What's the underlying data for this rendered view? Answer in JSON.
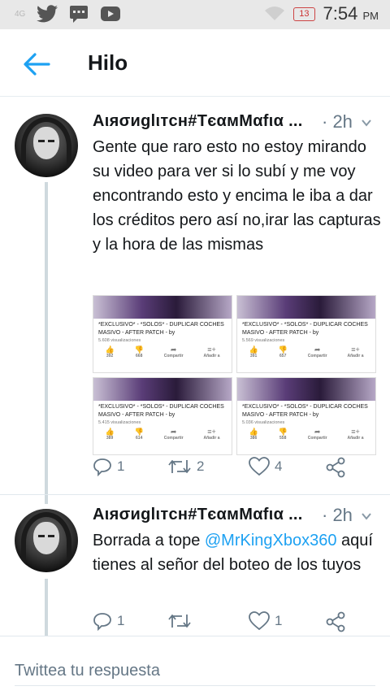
{
  "status_bar": {
    "network": "4G",
    "notification_count": "13",
    "time": "7:54",
    "ampm": "PM",
    "icons": [
      "twitter-icon",
      "message-icon",
      "youtube-icon",
      "wifi-icon"
    ]
  },
  "app_bar": {
    "title": "Hilo",
    "back_icon": "arrow-left-icon",
    "accent": "#1da1f2"
  },
  "tweets": [
    {
      "name": "Aιяσиglιтcн#TєαмMαfια ...",
      "time": "· 2h",
      "text": "Gente que raro esto no estoy mirando su video para ver si lo subí y me voy encontrando esto y encima le iba a dar los créditos pero así no,irar las capturas y la hora de las mismas",
      "media": [
        {
          "title": "*EXCLUSIVO* - *SOLOS* - DUPLICAR COCHES MASIVO - AFTER PATCH - by",
          "views": "5.608 visualizaciones",
          "likes": "392",
          "dislikes": "668",
          "share": "Compartir",
          "add": "Añadir a"
        },
        {
          "title": "*EXCLUSIVO* - *SOLOS* - DUPLICAR COCHES MASIVO - AFTER PATCH - by",
          "views": "5.569 visualizaciones",
          "likes": "391",
          "dislikes": "657",
          "share": "Compartir",
          "add": "Añadir a"
        },
        {
          "title": "*EXCLUSIVO* - *SOLOS* - DUPLICAR COCHES MASIVO - AFTER PATCH - by",
          "views": "5.415 visualizaciones",
          "likes": "389",
          "dislikes": "614",
          "share": "Compartir",
          "add": "Añadir a"
        },
        {
          "title": "*EXCLUSIVO* - *SOLOS* - DUPLICAR COCHES MASIVO - AFTER PATCH - by",
          "views": "5.036 visualizaciones",
          "likes": "386",
          "dislikes": "558",
          "share": "Compartir",
          "add": "Añadir a"
        }
      ],
      "replies": "1",
      "retweets": "2",
      "likes": "4"
    },
    {
      "name": "Aιяσиglιтcн#TєαмMαfια ...",
      "time": "· 2h",
      "text_before": "Borrada a tope ",
      "mention": "@MrKingXbox360",
      "text_after": " aquí tienes al señor del boteo de los tuyos",
      "replies": "1",
      "retweets": "",
      "likes": "1"
    }
  ],
  "reply_box": {
    "placeholder": "Twittea tu respuesta"
  }
}
